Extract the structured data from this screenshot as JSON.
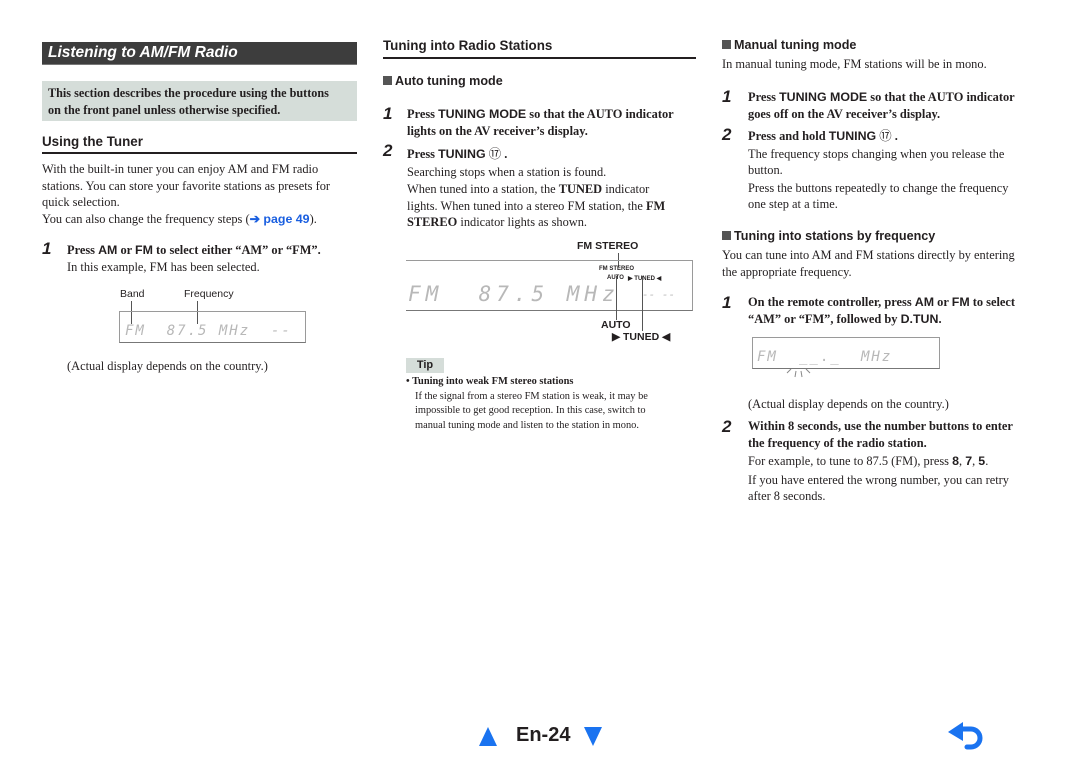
{
  "page": {
    "section_title": "Listening to AM/FM Radio",
    "page_number": "En-24",
    "accent_color": "#1a73f0"
  },
  "left": {
    "intro_line1": "This section describes the procedure using the buttons",
    "intro_line2": "on the front panel unless otherwise specified.",
    "heading": "Using the Tuner",
    "para1_line1": "With the built-in tuner you can enjoy AM and FM radio",
    "para1_line2": "stations. You can store your favorite stations as presets for",
    "para1_line3": "quick selection.",
    "para2_prefix": "You can also change the frequency steps (",
    "para2_link": "➔ page 49",
    "para2_suffix": ").",
    "step1": {
      "num": "1",
      "t1": "Press ",
      "k1": "AM",
      "t2": " or ",
      "k2": "FM",
      "t3": " to select either “AM” or “FM”.",
      "sub": "In this example, FM has been selected."
    },
    "display": {
      "band_label": "Band",
      "frequency_label": "Frequency",
      "lcd_text": "FM  87.5 MHz  --"
    },
    "note": "(Actual display depends on the country.)"
  },
  "middle": {
    "heading": "Tuning into Radio Stations",
    "auto_heading": "Auto tuning mode",
    "step1": {
      "num": "1",
      "t1": "Press ",
      "k1": "TUNING MODE",
      "t2": " so that the AUTO indicator",
      "line2": "lights on the AV receiver’s display."
    },
    "step2": {
      "num": "2",
      "t1": "Press ",
      "k1": "TUNING",
      "ref": "⑰",
      "t2": " .",
      "sub1": "Searching stops when a station is found.",
      "sub2_a": "When tuned into a station, the ",
      "sub2_b": "TUNED",
      "sub2_c": " indicator",
      "sub3_a": "lights. When tuned into a stereo FM station, the ",
      "sub3_b": "FM",
      "sub4_a": "STEREO",
      "sub4_b": " indicator lights as shown."
    },
    "display": {
      "fm_stereo_callout": "FM STEREO",
      "lcd_text": "FM  87.5 MHz",
      "lcd_dash": "-- --",
      "lcd_fm_stereo": "FM STEREO",
      "lcd_auto": "AUTO",
      "lcd_tuned": "▶ TUNED ◀",
      "auto_callout": "AUTO",
      "tuned_callout": "▶ TUNED ◀"
    },
    "tip": {
      "label": "Tip",
      "title": "Tuning into weak FM stereo stations",
      "line1": "If the signal from a stereo FM station is weak, it may be",
      "line2": "impossible to get good reception. In this case, switch to",
      "line3": "manual tuning mode and listen to the station in mono."
    }
  },
  "right": {
    "manual_heading": "Manual tuning mode",
    "manual_desc": "In manual tuning mode, FM stations will be in mono.",
    "step1": {
      "num": "1",
      "t1": "Press ",
      "k1": "TUNING MODE",
      "t2": " so that the AUTO indicator",
      "line2": "goes off on the AV receiver’s display."
    },
    "step2": {
      "num": "2",
      "t1": "Press and hold ",
      "k1": "TUNING",
      "ref": "⑰",
      "t2": " .",
      "sub1": "The frequency stops changing when you release the",
      "sub2": "button.",
      "sub3": "Press the buttons repeatedly to change the frequency",
      "sub4": "one step at a time."
    },
    "freq_heading": "Tuning into stations by frequency",
    "freq_desc1": "You can tune into AM and FM stations directly by entering",
    "freq_desc2": "the appropriate frequency.",
    "step3": {
      "num": "1",
      "t1": "On the remote controller, press ",
      "k1": "AM",
      "t2": " or ",
      "k2": "FM",
      "t3": " to select",
      "line2a": "“AM” or “FM”, followed by ",
      "line2b": "D.TUN",
      "line2c": "."
    },
    "display": {
      "lcd_fm": "FM",
      "lcd_blank": "__._",
      "lcd_mhz": "MHz"
    },
    "note": "(Actual display depends on the country.)",
    "step4": {
      "num": "2",
      "line1": "Within 8 seconds, use the number buttons to enter",
      "line2": "the frequency of the radio station.",
      "sub1_a": "For example, to tune to 87.5 (FM), press ",
      "sub1_b": "8",
      "sub1_c": ", ",
      "sub1_d": "7",
      "sub1_e": ", ",
      "sub1_f": "5",
      "sub1_g": ".",
      "sub2": "If you have entered the wrong number, you can retry",
      "sub3": "after 8 seconds."
    }
  },
  "nav": {
    "prev_icon": "triangle-up-icon",
    "next_icon": "triangle-down-icon",
    "back_icon": "return-arrow-icon"
  }
}
